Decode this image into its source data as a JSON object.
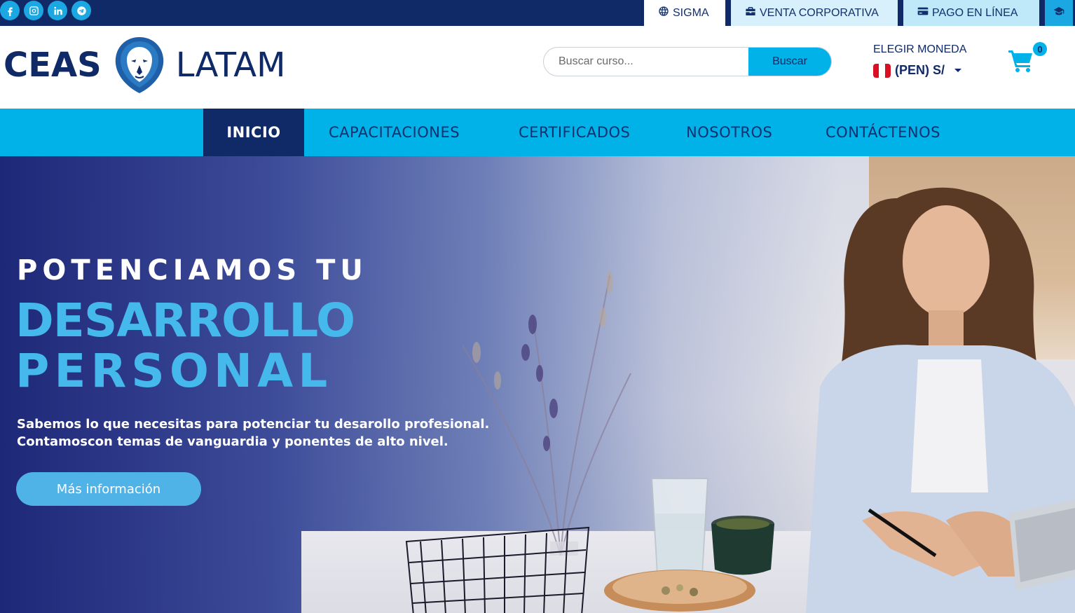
{
  "topbar": {
    "socials": [
      {
        "icon": "facebook-icon",
        "glyph": "f"
      },
      {
        "icon": "instagram-icon",
        "glyph": ""
      },
      {
        "icon": "linkedin-icon",
        "glyph": "in"
      },
      {
        "icon": "telegram-icon",
        "glyph": ""
      }
    ],
    "links": {
      "sigma": {
        "label": "SIGMA",
        "icon": "globe-icon"
      },
      "venta": {
        "label": "VENTA CORPORATIVA",
        "icon": "briefcase-icon"
      },
      "pago": {
        "label": "PAGO EN LÍNEA",
        "icon": "credit-card-icon"
      },
      "extra": {
        "icon": "graduation-cap-icon"
      }
    }
  },
  "header": {
    "logo": {
      "left": "CEAS",
      "right": "LATAM"
    },
    "search": {
      "placeholder": "Buscar curso...",
      "button": "Buscar"
    },
    "currency": {
      "label": "ELEGIR MONEDA",
      "selected": "(PEN) S/",
      "flag": "peru-flag"
    },
    "cart": {
      "count": "0"
    }
  },
  "nav": {
    "items": [
      "INICIO",
      "CAPACITACIONES",
      "CERTIFICADOS",
      "NOSOTROS",
      "CONTÁCTENOS"
    ],
    "active": "INICIO"
  },
  "hero": {
    "line1": "POTENCIAMOS TU",
    "line2": "DESARROLLO",
    "line3": "PERSONAL",
    "desc1": "Sabemos lo que necesitas para potenciar tu desarollo profesional.",
    "desc2": "Contamoscon temas de vanguardia y ponentes de alto nivel.",
    "button": "Más información"
  },
  "colors": {
    "navy": "#0f2a66",
    "cyan": "#00b2e8",
    "hero_accent": "#45b8ec"
  }
}
